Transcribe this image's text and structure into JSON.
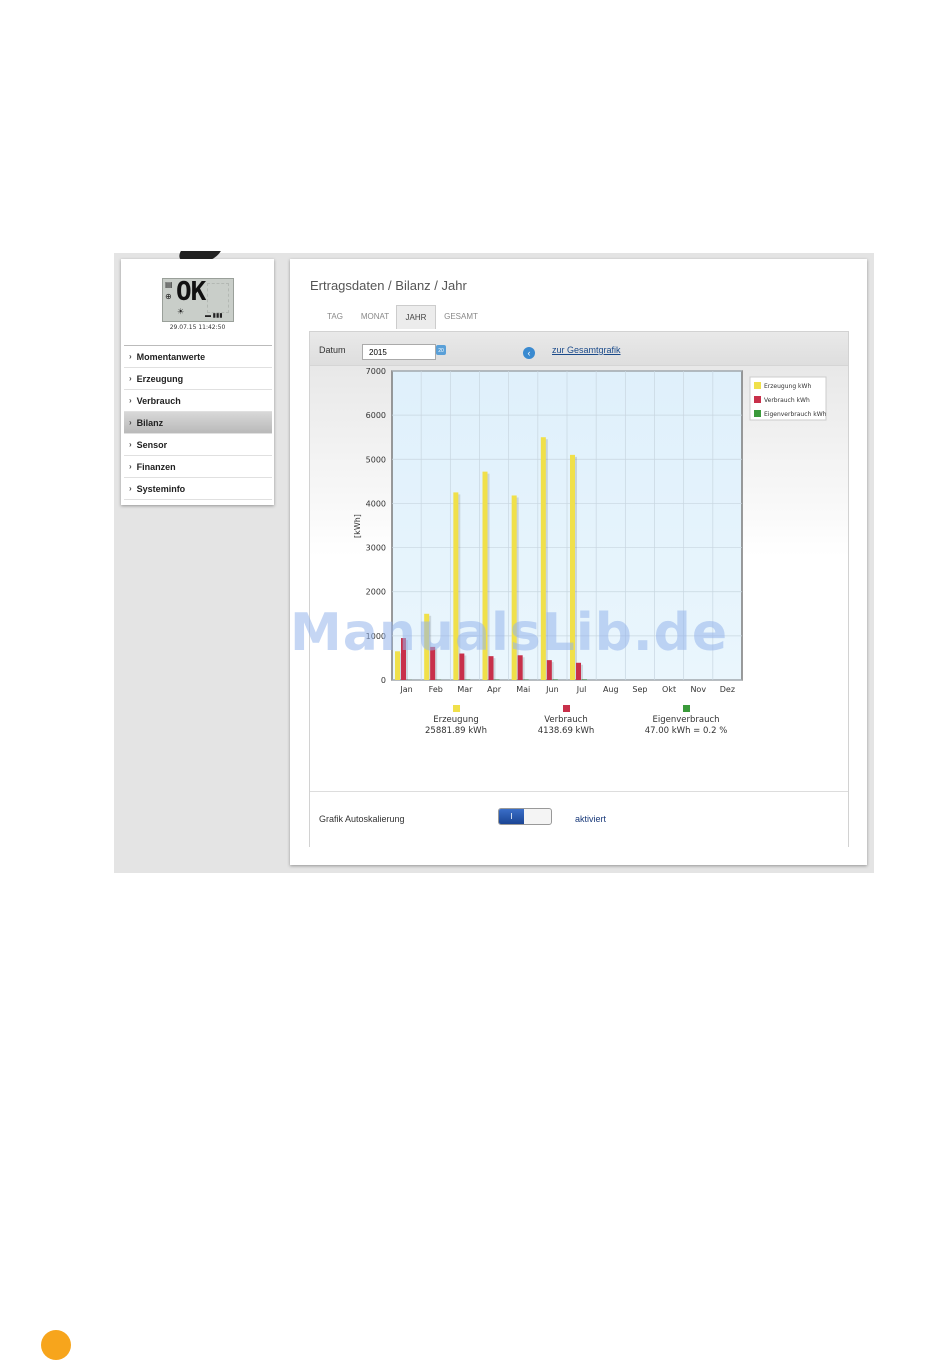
{
  "sidebar": {
    "lcd_text": "OK",
    "datetime": "29.07.15 11:42:50",
    "items": [
      {
        "label": "Momentanwerte"
      },
      {
        "label": "Erzeugung"
      },
      {
        "label": "Verbrauch"
      },
      {
        "label": "Bilanz",
        "active": true
      },
      {
        "label": "Sensor"
      },
      {
        "label": "Finanzen"
      },
      {
        "label": "Systeminfo"
      }
    ]
  },
  "main": {
    "breadcrumb": "Ertragsdaten / Bilanz / Jahr",
    "tabs": [
      {
        "label": "TAG"
      },
      {
        "label": "MONAT"
      },
      {
        "label": "JAHR",
        "active": true
      },
      {
        "label": "GESAMT"
      }
    ],
    "datum_label": "Datum",
    "datum_value": "2015",
    "calendar_icon": "calendar-icon",
    "back_icon": "back-arrow-icon",
    "gesamt_link": "zur Gesamtgrafik",
    "setting_label": "Grafik Autoskalierung",
    "toggle_text": "I",
    "setting_status": "aktiviert",
    "summary": [
      {
        "name": "Erzeugung",
        "value": "25881.89 kWh",
        "color": "#f0e04a"
      },
      {
        "name": "Verbrauch",
        "value": "4138.69 kWh",
        "color": "#c8304a"
      },
      {
        "name": "Eigenverbrauch",
        "value": "47.00 kWh = 0.2 %",
        "color": "#3a9a3a"
      }
    ]
  },
  "watermark": "ManualsLib.de",
  "chart_data": {
    "type": "bar",
    "categories": [
      "Jan",
      "Feb",
      "Mar",
      "Apr",
      "Mai",
      "Jun",
      "Jul",
      "Aug",
      "Sep",
      "Okt",
      "Nov",
      "Dez"
    ],
    "ylabel": "[kWh]",
    "ylim": [
      0,
      7000
    ],
    "yticks": [
      0,
      1000,
      2000,
      3000,
      4000,
      5000,
      6000,
      7000
    ],
    "grid": true,
    "legend_position": "top-right",
    "series": [
      {
        "name": "Erzeugung kWh",
        "color": "#f0e04a",
        "values": [
          650,
          1500,
          4250,
          4720,
          4180,
          5500,
          5100,
          0,
          0,
          0,
          0,
          0
        ]
      },
      {
        "name": "Verbrauch kWh",
        "color": "#c8304a",
        "values": [
          950,
          750,
          600,
          540,
          560,
          450,
          390,
          0,
          0,
          0,
          0,
          0
        ]
      },
      {
        "name": "Eigenverbrauch kWh",
        "color": "#3a9a3a",
        "values": [
          2,
          4,
          6,
          7,
          7,
          10,
          11,
          0,
          0,
          0,
          0,
          0
        ]
      }
    ]
  }
}
